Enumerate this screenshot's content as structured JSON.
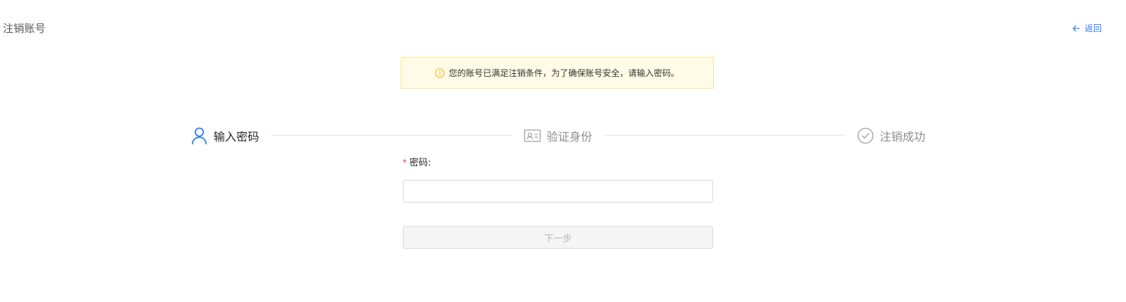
{
  "header": {
    "title": "注销账号",
    "back_label": "返回",
    "back_icon": "arrow-left-icon"
  },
  "notice": {
    "icon": "info-circle-icon",
    "text": "您的账号已满足注销条件，为了确保账号安全，请输入密码。"
  },
  "steps": [
    {
      "label": "输入密码",
      "icon": "user-icon",
      "status": "active"
    },
    {
      "label": "验证身份",
      "icon": "id-card-icon",
      "status": "pending"
    },
    {
      "label": "注销成功",
      "icon": "check-circle-icon",
      "status": "pending"
    }
  ],
  "form": {
    "password_label": "密码",
    "password_label_suffix": ":",
    "required_mark": "*",
    "password_value": "",
    "password_placeholder": "",
    "next_button_label": "下一步",
    "next_button_disabled": true
  },
  "colors": {
    "accent": "#2f7cf6",
    "warning_bg": "#fffbe6",
    "warning_border": "#ffe58f",
    "warning_icon": "#faad14",
    "required": "#f5222d",
    "step_pending": "#8c8c8c"
  }
}
